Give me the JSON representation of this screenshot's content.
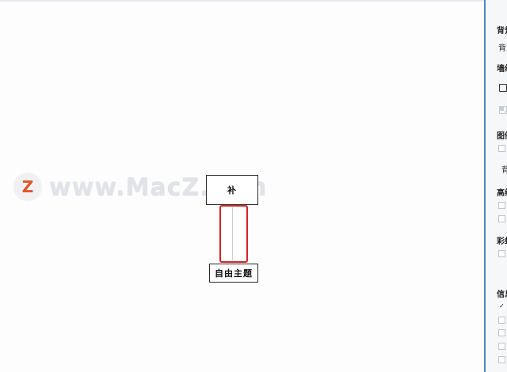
{
  "canvas": {
    "top_topic_text": "补",
    "bottom_topic_text": "自由主题",
    "watermark": {
      "logo_letter": "Z",
      "text": "www.MacZ.com"
    }
  },
  "panel": {
    "items": [
      {
        "name": "panel-heading-1",
        "text": "背景"
      },
      {
        "name": "panel-item-2",
        "text": "背景"
      },
      {
        "name": "panel-heading-3",
        "text": "墙纸"
      },
      {
        "name": "panel-heading-4",
        "text": "图例"
      },
      {
        "name": "panel-item-5",
        "text": "背景"
      },
      {
        "name": "panel-heading-6",
        "text": "高级"
      },
      {
        "name": "panel-heading-7",
        "text": "彩虹"
      },
      {
        "name": "panel-heading-8",
        "text": "信息"
      }
    ],
    "checkmark": "✓"
  },
  "colors": {
    "selection": "#d32323",
    "panel_accent": "#4a87c5",
    "logo": "#e0562a"
  }
}
